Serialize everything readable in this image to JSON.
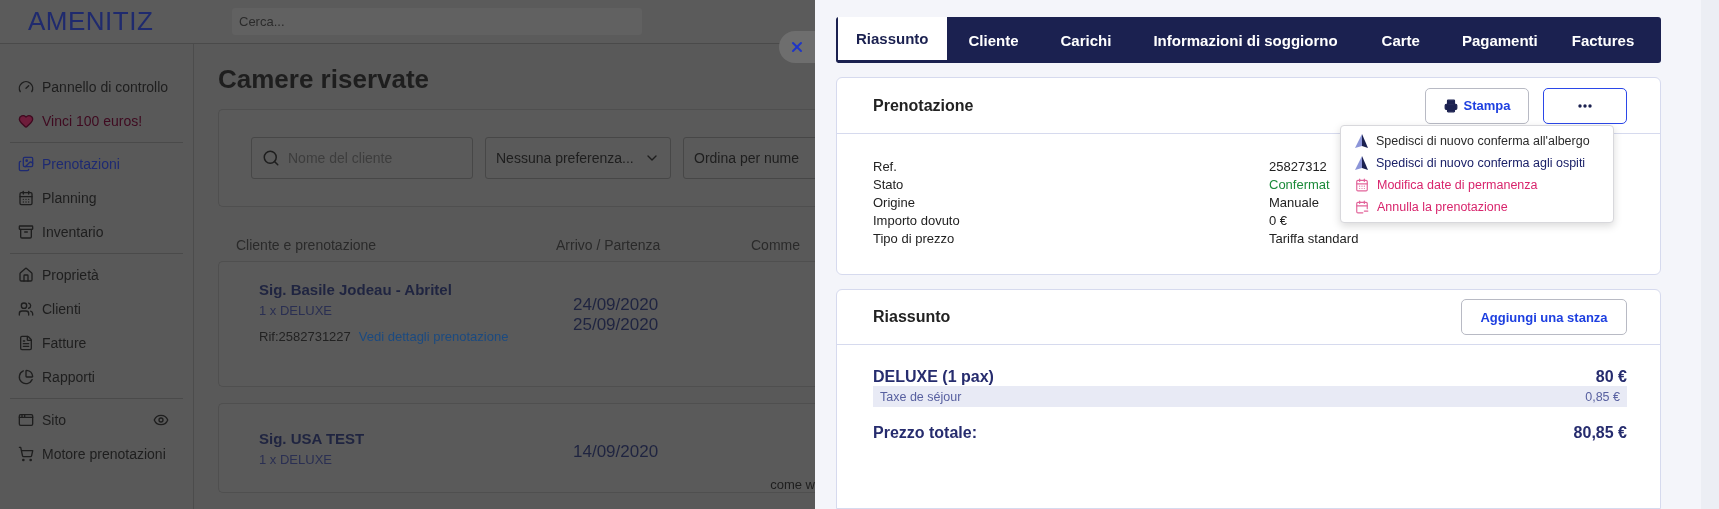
{
  "header": {
    "logo": "AMENITIZ",
    "search_placeholder": "Cerca..."
  },
  "sidebar": {
    "groups": [
      [
        {
          "label": "Pannello di controllo",
          "kind": "link",
          "selected": false
        },
        {
          "label": "Vinci 100 euros!",
          "kind": "promo",
          "selected": false
        }
      ],
      [
        {
          "label": "Prenotazioni",
          "kind": "link",
          "selected": true
        },
        {
          "label": "Planning",
          "kind": "link",
          "selected": false
        },
        {
          "label": "Inventario",
          "kind": "link",
          "selected": false
        }
      ],
      [
        {
          "label": "Proprietà",
          "kind": "link",
          "selected": false
        },
        {
          "label": "Clienti",
          "kind": "link",
          "selected": false
        },
        {
          "label": "Fatture",
          "kind": "link",
          "selected": false
        },
        {
          "label": "Rapporti",
          "kind": "link",
          "selected": false
        }
      ],
      [
        {
          "label": "Sito",
          "kind": "preview",
          "selected": false
        },
        {
          "label": "Motore prenotazioni",
          "kind": "link",
          "selected": false
        }
      ]
    ]
  },
  "main": {
    "title": "Camere riservate",
    "filters": {
      "search_placeholder": "Nome del cliente",
      "preference": "Nessuna preferenza...",
      "sort": "Ordina per nume"
    },
    "columns": [
      "Cliente e prenotazione",
      "Arrivo / Partenza",
      "Comme"
    ],
    "bookings": [
      {
        "name": "Sig. Basile Jodeau - Abritel",
        "room": "1 x DELUXE",
        "ref": "Rif:2582731227",
        "link": "Vedi dettagli prenotazione",
        "arrival": "24/09/2020",
        "departure": "25/09/2020"
      },
      {
        "name": "Sig. USA TEST",
        "room": "1 x DELUXE",
        "arrival": "14/09/2020",
        "comment": "come w"
      }
    ]
  },
  "panel": {
    "tabs": [
      {
        "label": "Riassunto",
        "selected": true
      },
      {
        "label": "Cliente",
        "selected": false
      },
      {
        "label": "Carichi",
        "selected": false
      },
      {
        "label": "Informazioni di soggiorno",
        "selected": false
      },
      {
        "label": "Carte",
        "selected": false
      },
      {
        "label": "Pagamenti",
        "selected": false
      },
      {
        "label": "Factures",
        "selected": false
      }
    ],
    "reservation": {
      "title": "Prenotazione",
      "print_button": "Stampa",
      "more_expanded": true,
      "details": [
        {
          "label": "Ref.",
          "value": "25827312",
          "kind": "text"
        },
        {
          "label": "Stato",
          "value": "Confermat",
          "kind": "status"
        },
        {
          "label": "Origine",
          "value": "Manuale",
          "kind": "text"
        },
        {
          "label": "Importo dovuto",
          "value": "0 €",
          "kind": "text"
        },
        {
          "label": "Tipo di prezzo",
          "value": "Tariffa standard",
          "kind": "text"
        }
      ],
      "menu": [
        {
          "label": "Spedisci di nuovo conferma all'albergo",
          "kind": "send",
          "highlighted": false
        },
        {
          "label": "Spedisci di nuovo conferma agli ospiti",
          "kind": "send",
          "highlighted": true
        },
        {
          "label": "Modifica date di permanenza",
          "kind": "edit",
          "highlighted": false
        },
        {
          "label": "Annulla la prenotazione",
          "kind": "cancel",
          "highlighted": false
        }
      ]
    },
    "summary": {
      "title": "Riassunto",
      "add_button": "Aggiungi una stanza",
      "lines": [
        {
          "label": "DELUXE (1 pax)",
          "amount": "80 €",
          "kind": "room"
        },
        {
          "label": "Taxe de séjour",
          "amount": "0,85 €",
          "kind": "tax"
        }
      ],
      "total": {
        "label": "Prezzo totale:",
        "amount": "80,85 €"
      }
    }
  }
}
